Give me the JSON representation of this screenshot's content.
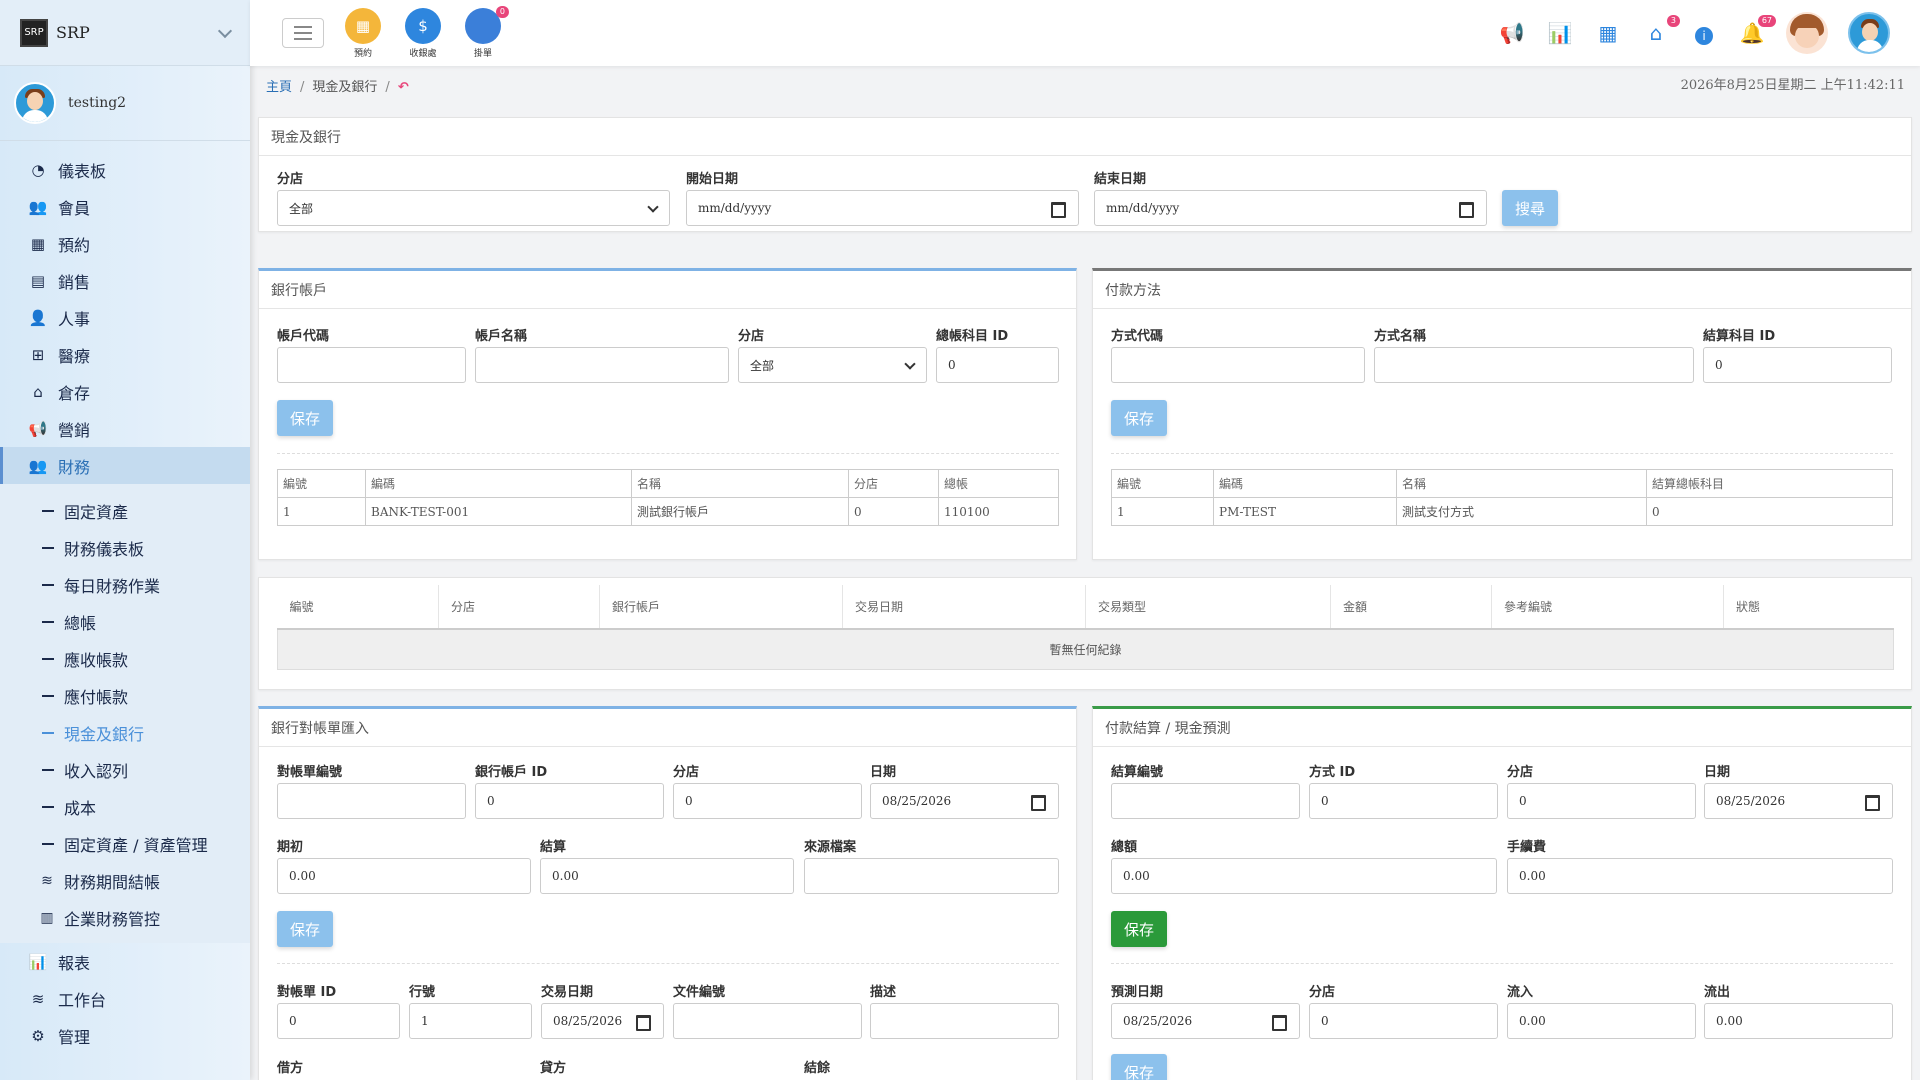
{
  "sidebar": {
    "brand_logo": "SRP",
    "brand": "SRP",
    "username": "testing2",
    "nav": [
      {
        "label": "儀表板",
        "icon": "◔"
      },
      {
        "label": "會員",
        "icon": "👥"
      },
      {
        "label": "預約",
        "icon": "▦"
      },
      {
        "label": "銷售",
        "icon": "▤"
      },
      {
        "label": "人事",
        "icon": "👤"
      },
      {
        "label": "醫療",
        "icon": "⊞"
      },
      {
        "label": "倉存",
        "icon": "⌂"
      },
      {
        "label": "營銷",
        "icon": "📢"
      },
      {
        "label": "財務",
        "icon": "👥"
      }
    ],
    "finance_sub": [
      {
        "label": "固定資產"
      },
      {
        "label": "財務儀表板"
      },
      {
        "label": "每日財務作業"
      },
      {
        "label": "總帳"
      },
      {
        "label": "應收帳款"
      },
      {
        "label": "應付帳款"
      },
      {
        "label": "現金及銀行"
      },
      {
        "label": "收入認列"
      },
      {
        "label": "成本"
      },
      {
        "label": "固定資產 / 資產管理"
      },
      {
        "label": "財務期間結帳",
        "icon": "≋"
      },
      {
        "label": "企業財務管控",
        "icon": "▥"
      }
    ],
    "nav_bottom": [
      {
        "label": "報表",
        "icon": "📊"
      },
      {
        "label": "工作台",
        "icon": "≋"
      },
      {
        "label": "管理",
        "icon": "⚙"
      }
    ]
  },
  "topbar": {
    "quick": [
      {
        "label": "預約",
        "color": "#f4b63a",
        "icon": "▦"
      },
      {
        "label": "收銀處",
        "color": "#2e86de",
        "icon": "$"
      },
      {
        "label": "掛單",
        "color": "#3b7fd9",
        "icon": "",
        "badge": "0"
      }
    ],
    "badges": {
      "gift": "3",
      "bell": "67"
    }
  },
  "breadcrumb": {
    "home": "主頁",
    "current": "現金及銀行"
  },
  "datetime": "2026年8月25日星期二 上午11:42:11",
  "filter": {
    "title": "現金及銀行",
    "branch_label": "分店",
    "branch_value": "全部",
    "start_label": "開始日期",
    "start_value": "mm/dd/yyyy",
    "end_label": "結束日期",
    "end_value": "mm/dd/yyyy",
    "search": "搜尋"
  },
  "bank": {
    "title": "銀行帳戶",
    "code_label": "帳戶代碼",
    "name_label": "帳戶名稱",
    "branch_label": "分店",
    "branch_value": "全部",
    "gl_label": "總帳科目 ID",
    "gl_value": "0",
    "save": "保存",
    "headers": [
      "編號",
      "編碼",
      "名稱",
      "分店",
      "總帳"
    ],
    "rows": [
      [
        "1",
        "BANK-TEST-001",
        "測試銀行帳戶",
        "0",
        "110100"
      ]
    ]
  },
  "payment": {
    "title": "付款方法",
    "code_label": "方式代碼",
    "name_label": "方式名稱",
    "gl_label": "結算科目 ID",
    "gl_value": "0",
    "save": "保存",
    "headers": [
      "編號",
      "編碼",
      "名稱",
      "結算總帳科目"
    ],
    "rows": [
      [
        "1",
        "PM-TEST",
        "測試支付方式",
        "0"
      ]
    ]
  },
  "txn": {
    "headers": [
      "編號",
      "分店",
      "銀行帳戶",
      "交易日期",
      "交易類型",
      "金額",
      "參考編號",
      "狀態"
    ],
    "empty": "暫無任何紀錄"
  },
  "recon": {
    "title": "銀行對帳單匯入",
    "stmt_label": "對帳單編號",
    "acct_label": "銀行帳戶 ID",
    "acct_value": "0",
    "branch_label": "分店",
    "branch_value": "0",
    "date_label": "日期",
    "date_value": "08/25/2026",
    "open_label": "期初",
    "open_value": "0.00",
    "close_label": "結算",
    "close_value": "0.00",
    "src_label": "來源檔案",
    "save": "保存",
    "sid_label": "對帳單 ID",
    "sid_value": "0",
    "line_label": "行號",
    "line_value": "1",
    "tdate_label": "交易日期",
    "tdate_value": "08/25/2026",
    "doc_label": "文件編號",
    "desc_label": "描述",
    "debit_label": "借方",
    "credit_label": "貸方",
    "balance_label": "結餘"
  },
  "settle": {
    "title": "付款結算 / 現金預測",
    "no_label": "結算編號",
    "method_label": "方式 ID",
    "method_value": "0",
    "branch_label": "分店",
    "branch_value": "0",
    "date_label": "日期",
    "date_value": "08/25/2026",
    "gross_label": "總額",
    "gross_value": "0.00",
    "fee_label": "手續費",
    "fee_value": "0.00",
    "save": "保存",
    "fdate_label": "預測日期",
    "fdate_value": "08/25/2026",
    "fbranch_label": "分店",
    "fbranch_value": "0",
    "in_label": "流入",
    "in_value": "0.00",
    "out_label": "流出",
    "out_value": "0.00",
    "save2": "保存"
  }
}
